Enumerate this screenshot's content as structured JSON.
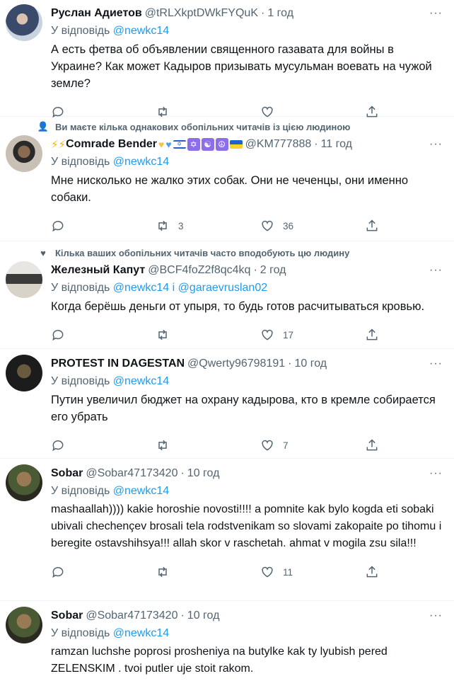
{
  "tweets": [
    {
      "context": "",
      "name": "Руслан Адиетов",
      "handle": "@tRLXkptDWkFYQuK",
      "dot": "·",
      "time": "1 год",
      "reply_prefix": "У відповідь",
      "mentions": "@newkc14",
      "text": "А есть фетва об объявлении священного газавата для войны в Украине? Как может Кадыров призывать мусульман воевать на чужой земле?",
      "retweets": "",
      "likes": ""
    },
    {
      "context": "Ви маєте кілька однакових обопільних читачів із цією людиною",
      "name": "Comrade Bender",
      "handle": "@KM777888",
      "dot": "·",
      "time": "11 год",
      "reply_prefix": "У відповідь",
      "mentions": "@newkc14",
      "text": "Мне нисколько не жалко этих собак. Они не чеченцы, они именно собаки.",
      "retweets": "3",
      "likes": "36"
    },
    {
      "context": "Кілька ваших обопільних читачів часто вподобують цю людину",
      "name": "Железный Капут",
      "handle": "@BCF4foZ2f8qc4kq",
      "dot": "·",
      "time": "2 год",
      "reply_prefix": "У відповідь",
      "mentions": "@newkc14 і @garaevruslan02",
      "text": "Когда берёшь деньги от упыря, то будь готов расчитываться кровью.",
      "retweets": "",
      "likes": "17"
    },
    {
      "context": "",
      "name": "PROTEST IN DAGESTAN",
      "handle": "@Qwerty96798191",
      "dot": "·",
      "time": "10 год",
      "reply_prefix": "У відповідь",
      "mentions": "@newkc14",
      "text": "Путин увеличил бюджет на охрану кадырова, кто в кремле собирается его убрать",
      "retweets": "",
      "likes": "7"
    },
    {
      "context": "",
      "name": "Sobar",
      "handle": "@Sobar47173420",
      "dot": "·",
      "time": "10 год",
      "reply_prefix": "У відповідь",
      "mentions": "@newkc14",
      "text": "mashaallah)))) kakie horoshie novosti!!!! a pomnite kak bylo kogda eti sobaki ubivali chechençev brosali tela rodstvenikam so slovami zakopaite po tihomu i beregite ostavshihsya!!! allah skor v raschetah. ahmat v mogila zsu sila!!!",
      "retweets": "",
      "likes": "11"
    },
    {
      "context": "",
      "name": "Sobar",
      "handle": "@Sobar47173420",
      "dot": "·",
      "time": "10 год",
      "reply_prefix": "У відповідь",
      "mentions": "@newkc14",
      "text": "ramzan luchshe poprosi prosheniya na butylke kak ty lyubish pered ZELENSKIM . tvoi putler uje stoit rakom.",
      "retweets": "",
      "likes": ""
    }
  ],
  "icons": {
    "reply": "reply-icon",
    "retweet": "retweet-icon",
    "like": "like-icon",
    "share": "share-icon",
    "more": "more-icon",
    "context_follow": "person-icon",
    "context_like": "heart-icon"
  },
  "colors": {
    "accent": "#1d9bf0",
    "secondary_text": "#536471",
    "divider": "#eff3f4"
  }
}
